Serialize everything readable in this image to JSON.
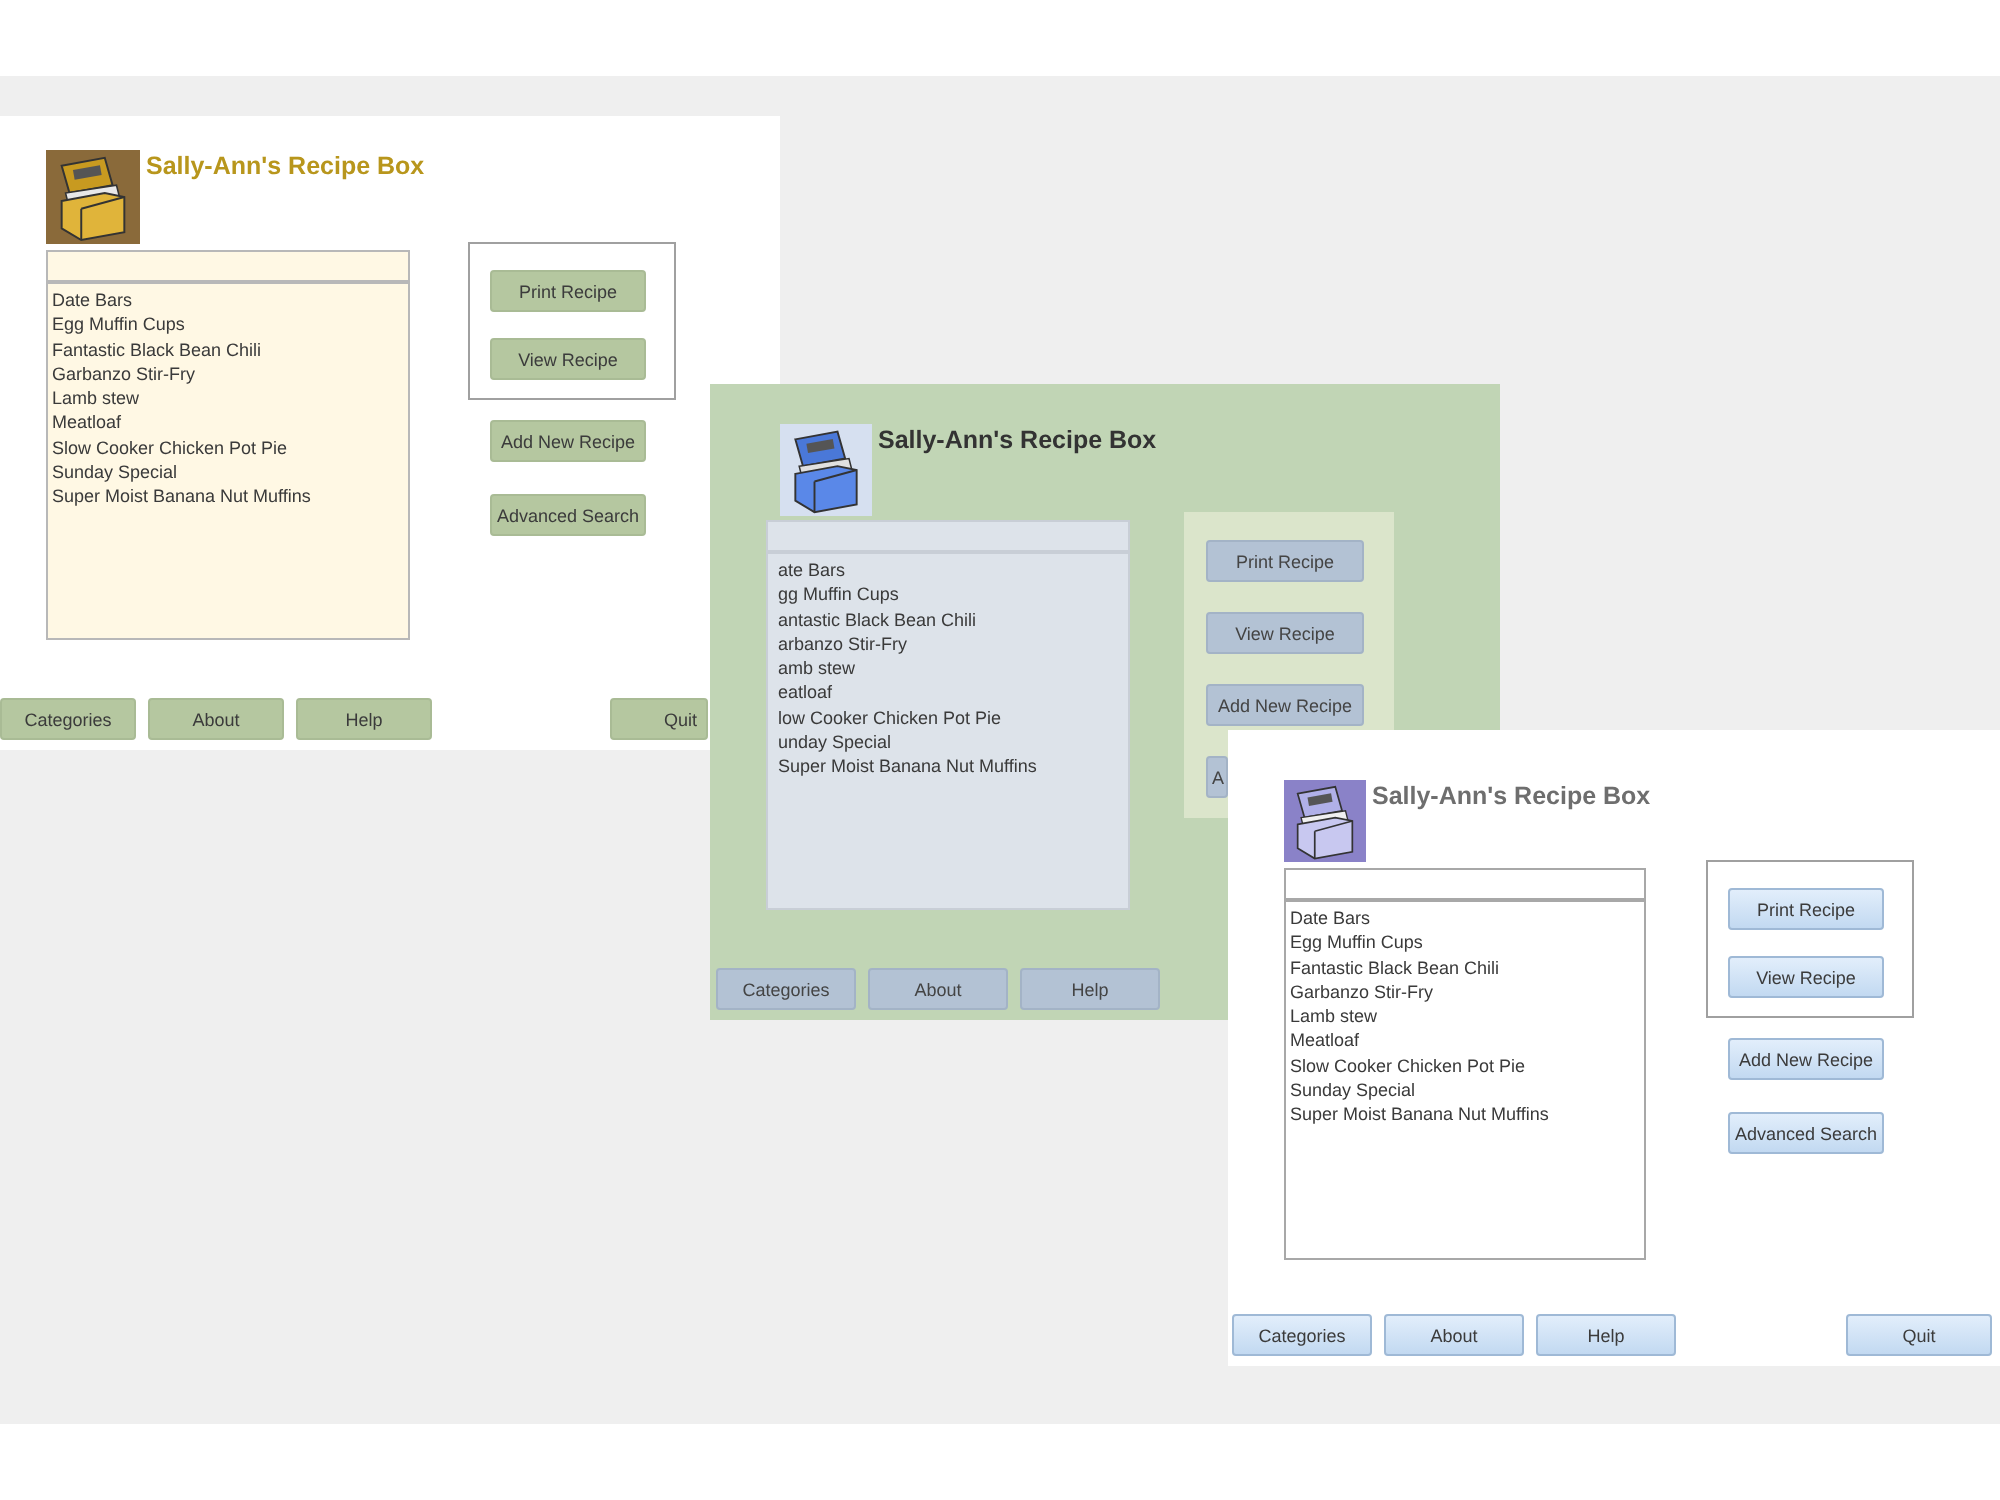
{
  "forms": [
    {
      "kind": "gold",
      "title": "Sally-Ann's Recipe Box",
      "recipes": [
        "Date Bars",
        "Egg Muffin Cups",
        "Fantastic Black Bean Chili",
        "Garbanzo Stir-Fry",
        "Lamb stew",
        "Meatloaf",
        "Slow Cooker Chicken Pot Pie",
        "Sunday Special",
        "Super Moist Banana Nut Muffins"
      ],
      "panel_buttons": [
        {
          "label": "Print Recipe"
        },
        {
          "label": "View Recipe"
        }
      ],
      "other_buttons": [
        {
          "label": "Add New Recipe"
        },
        {
          "label": "Advanced Search"
        }
      ],
      "footer_buttons": [
        {
          "label": "Categories"
        },
        {
          "label": "About"
        },
        {
          "label": "Help"
        }
      ],
      "quit_button": {
        "label": "Quit"
      }
    },
    {
      "kind": "green",
      "title": "Sally-Ann's Recipe Box",
      "recipes": [
        "ate Bars",
        "gg Muffin Cups",
        "antastic Black Bean Chili",
        "arbanzo Stir-Fry",
        "amb stew",
        "eatloaf",
        "low Cooker Chicken Pot Pie",
        "unday Special",
        "Super Moist Banana Nut Muffins"
      ],
      "panel_buttons": [
        {
          "label": "Print Recipe"
        },
        {
          "label": "View Recipe"
        },
        {
          "label": "Add New Recipe"
        },
        {
          "label": "A",
          "clipped": true
        }
      ],
      "footer_buttons": [
        {
          "label": "Categories"
        },
        {
          "label": "About"
        },
        {
          "label": "Help"
        }
      ]
    },
    {
      "kind": "blue",
      "title": "Sally-Ann's Recipe Box",
      "recipes": [
        "Date Bars",
        "Egg Muffin Cups",
        "Fantastic Black Bean Chili",
        "Garbanzo Stir-Fry",
        "Lamb stew",
        "Meatloaf",
        "Slow Cooker Chicken Pot Pie",
        "Sunday Special",
        "Super Moist Banana Nut Muffins"
      ],
      "panel_buttons": [
        {
          "label": "Print Recipe"
        },
        {
          "label": "View Recipe"
        }
      ],
      "other_buttons": [
        {
          "label": "Add New Recipe"
        },
        {
          "label": "Advanced Search"
        }
      ],
      "footer_buttons": [
        {
          "label": "Categories"
        },
        {
          "label": "About"
        },
        {
          "label": "Help"
        }
      ],
      "quit_button": {
        "label": "Quit"
      }
    }
  ]
}
